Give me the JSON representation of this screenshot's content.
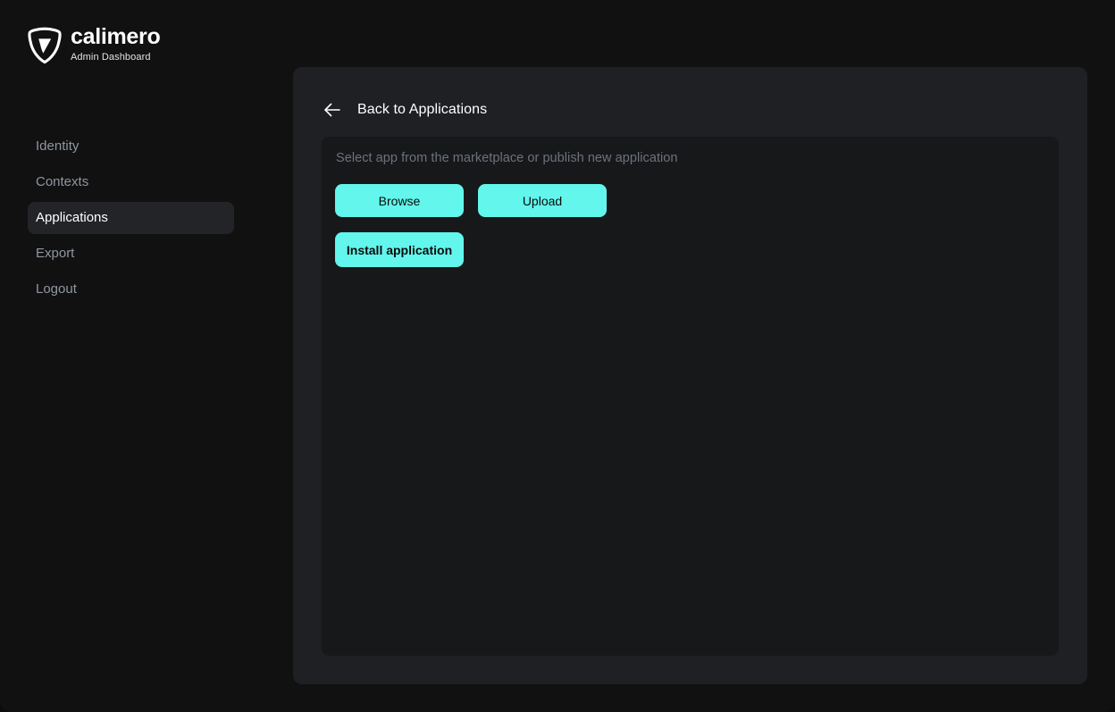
{
  "brand": {
    "name": "calimero",
    "subtitle": "Admin Dashboard",
    "logo_icon": "calimero-shield-icon"
  },
  "sidebar": {
    "items": [
      {
        "label": "Identity",
        "active": false
      },
      {
        "label": "Contexts",
        "active": false
      },
      {
        "label": "Applications",
        "active": true
      },
      {
        "label": "Export",
        "active": false
      },
      {
        "label": "Logout",
        "active": false
      }
    ]
  },
  "panel": {
    "back_icon": "arrow-left-icon",
    "title": "Back to Applications",
    "card": {
      "caption": "Select app from the marketplace or publish new application",
      "buttons": [
        {
          "label": "Browse",
          "name": "browse-button"
        },
        {
          "label": "Upload",
          "name": "upload-button"
        },
        {
          "label": "Install application",
          "name": "install-application-button"
        }
      ]
    }
  },
  "colors": {
    "page_background": "#111111",
    "panel_background": "#1f2023",
    "card_background": "#17181a",
    "accent": "#62f6ec",
    "active_nav_background": "#232427",
    "muted_text": "#6c727d",
    "nav_text": "#9096a0"
  }
}
